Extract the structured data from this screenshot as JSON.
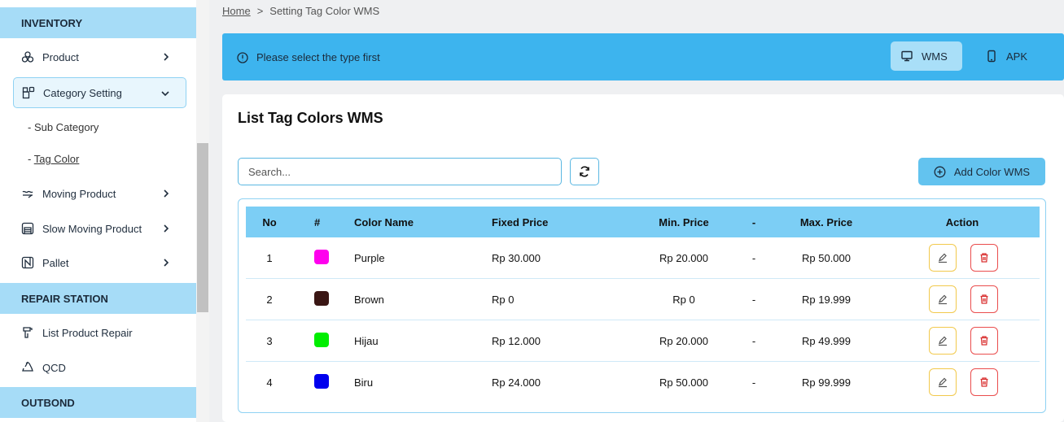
{
  "sidebar": {
    "sections": {
      "inventory": "INVENTORY",
      "repair_station": "REPAIR STATION",
      "outbond": "OUTBOND"
    },
    "items": {
      "product": "Product",
      "category_setting": "Category Setting",
      "sub_category": "- Sub Category",
      "tag_color_prefix": "- ",
      "tag_color": "Tag Color",
      "moving_product": "Moving Product",
      "slow_moving_product": "Slow Moving Product",
      "pallet": "Pallet",
      "list_product_repair": "List Product Repair",
      "qcd": "QCD"
    }
  },
  "breadcrumb": {
    "home": "Home",
    "separator": ">",
    "current": "Setting Tag Color WMS"
  },
  "banner": {
    "message": "Please select the type first",
    "wms_label": "WMS",
    "apk_label": "APK"
  },
  "card": {
    "title": "List Tag Colors WMS",
    "search_placeholder": "Search...",
    "add_label": "Add Color WMS"
  },
  "table": {
    "headers": {
      "no": "No",
      "hash": "#",
      "color_name": "Color Name",
      "fixed_price": "Fixed Price",
      "min_price": "Min. Price",
      "dash": "-",
      "max_price": "Max. Price",
      "action": "Action"
    },
    "rows": [
      {
        "no": "1",
        "color": "#ff00ee",
        "name": "Purple",
        "fixed": "Rp 30.000",
        "min": "Rp 20.000",
        "dash": "-",
        "max": "Rp 50.000"
      },
      {
        "no": "2",
        "color": "#3a1614",
        "name": "Brown",
        "fixed": "Rp 0",
        "min": "Rp 0",
        "dash": "-",
        "max": "Rp 19.999"
      },
      {
        "no": "3",
        "color": "#00ee00",
        "name": "Hijau",
        "fixed": "Rp 12.000",
        "min": "Rp 20.000",
        "dash": "-",
        "max": "Rp 49.999"
      },
      {
        "no": "4",
        "color": "#0000ee",
        "name": "Biru",
        "fixed": "Rp 24.000",
        "min": "Rp 50.000",
        "dash": "-",
        "max": "Rp 99.999"
      }
    ]
  },
  "colors": {
    "accent": "#3db4ee",
    "section_bg": "#a6dcf7",
    "header_bg": "#7ccef5",
    "edit_border": "#f2c94c",
    "delete_border": "#ea4d4d"
  }
}
